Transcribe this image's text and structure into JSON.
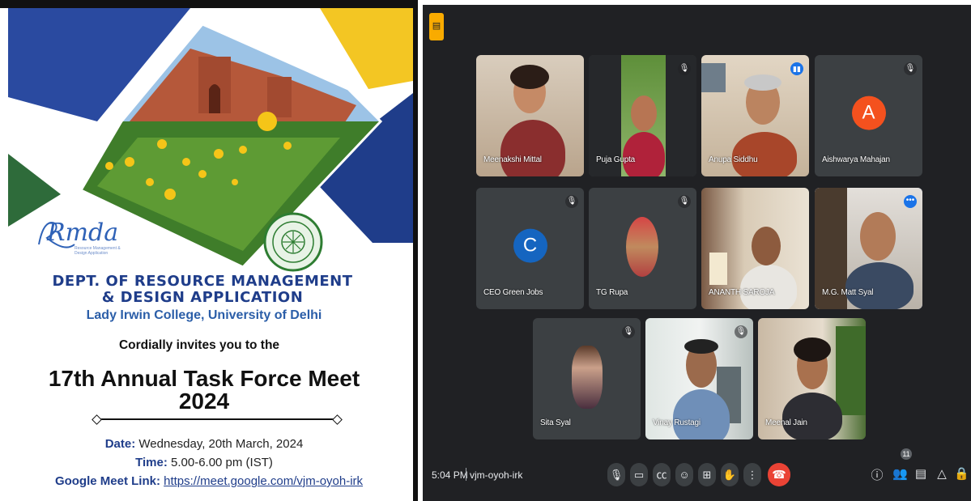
{
  "poster": {
    "dept_line1": "DEPT. OF RESOURCE MANAGEMENT",
    "dept_line2": "& DESIGN APPLICATION",
    "college": "Lady Irwin College, University of Delhi",
    "invite": "Cordially invites you to the",
    "title_line1": "17th Annual Task Force Meet",
    "title_line2": "2024",
    "date_label": "Date:",
    "date_value": "Wednesday, 20th March, 2024",
    "time_label": "Time:",
    "time_value": "5.00-6.00 pm (IST)",
    "link_label": "Google Meet Link:",
    "link_value": "https://meet.google.com/vjm-oyoh-irk",
    "logo_text": "Rmda",
    "logo_subtext": "Resource Management & Design Application",
    "colors": {
      "navy": "#1f3d8a",
      "blue": "#2b5ea8",
      "yellow": "#f3c623",
      "green": "#2e6b3a"
    }
  },
  "meet": {
    "participants": [
      {
        "name": "Meenakshi Mittal",
        "muted": false
      },
      {
        "name": "Puja Gupta",
        "muted": true
      },
      {
        "name": "Anupa Siddhu",
        "muted": false,
        "speaking": true
      },
      {
        "name": "Aishwarya Mahajan",
        "muted": true,
        "initial": "A",
        "avatar_color": "#f4511e"
      },
      {
        "name": "CEO Green Jobs",
        "muted": true,
        "initial": "C",
        "avatar_color": "#1565c0"
      },
      {
        "name": "TG Rupa",
        "muted": true
      },
      {
        "name": "ANANTH SAROJA",
        "muted": false
      },
      {
        "name": "M.G. Matt Syal",
        "muted": false,
        "pinned_menu": true
      },
      {
        "name": "Sita Syal",
        "muted": true
      },
      {
        "name": "Vinay Rustagi",
        "muted": true
      },
      {
        "name": "Meenal Jain",
        "muted": false
      }
    ],
    "time": "5:04 PM",
    "meeting_code": "vjm-oyoh-irk",
    "participant_count": "11",
    "controls": [
      "mic-icon",
      "camera-icon",
      "captions-icon",
      "emoji-icon",
      "present-icon",
      "raise-hand-icon",
      "more-options-icon",
      "end-call-icon"
    ],
    "right_controls": [
      "info-icon",
      "people-icon",
      "chat-icon",
      "activities-icon",
      "lock-icon"
    ]
  }
}
